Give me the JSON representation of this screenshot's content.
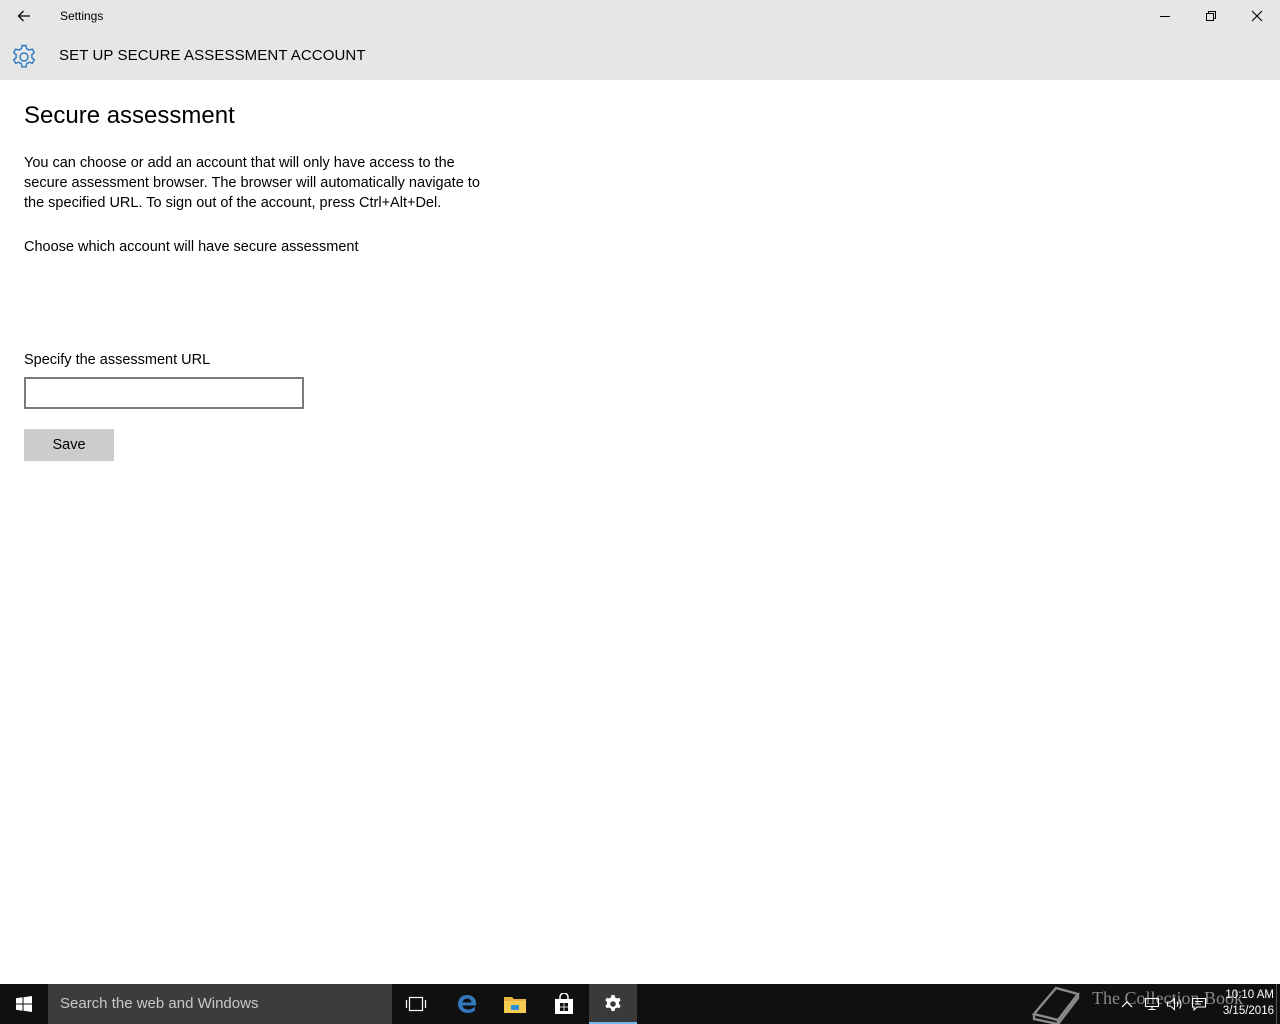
{
  "window": {
    "title": "Settings"
  },
  "header": {
    "title": "SET UP SECURE ASSESSMENT ACCOUNT",
    "icon": "gear-icon",
    "accent_color": "#2b78c5"
  },
  "content": {
    "page_title": "Secure assessment",
    "description": "You can choose or add an account that will only have access to the secure assessment browser. The browser will automatically navigate to the specified URL. To sign out of the account, press Ctrl+Alt+Del.",
    "choose_label": "Choose which account will have secure assessment",
    "url_label": "Specify the assessment URL",
    "url_value": "",
    "save_label": "Save"
  },
  "taskbar": {
    "search_placeholder": "Search the web and Windows",
    "pinned": [
      "task-view-icon",
      "edge-icon",
      "file-explorer-icon",
      "store-icon",
      "settings-icon"
    ],
    "watermark_text": "The Collection Book",
    "clock_time": "10:10 AM",
    "clock_date": "3/15/2016"
  }
}
